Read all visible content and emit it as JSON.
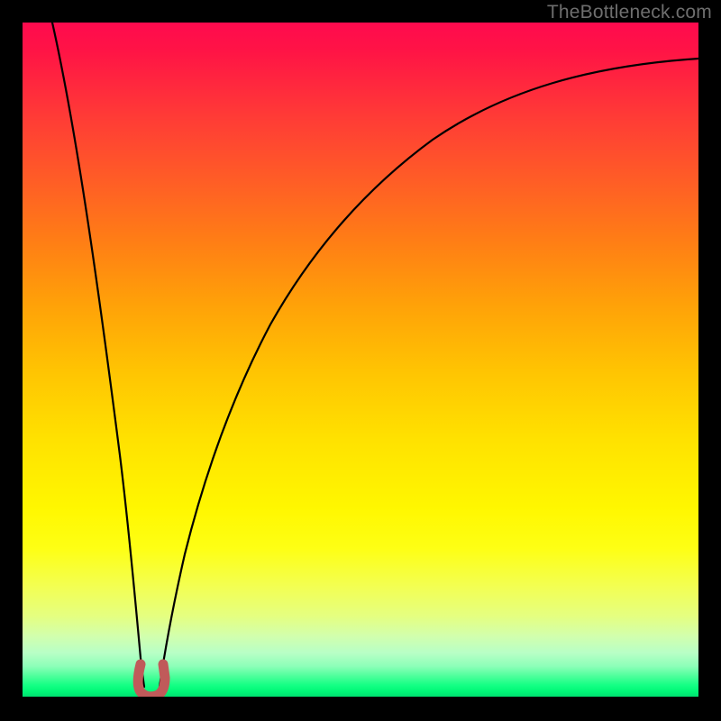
{
  "watermark": "TheBottleneck.com",
  "chart_data": {
    "type": "line",
    "title": "",
    "xlabel": "",
    "ylabel": "",
    "xlim": [
      0,
      100
    ],
    "ylim": [
      0,
      100
    ],
    "grid": false,
    "legend": false,
    "series": [
      {
        "name": "bottleneck-curve-left",
        "x": [
          0,
          2,
          4,
          6,
          8,
          10,
          12,
          14,
          15.5,
          16.5,
          17.3
        ],
        "values": [
          100,
          88,
          76,
          64,
          52,
          40,
          28,
          16,
          7,
          2,
          0.5
        ]
      },
      {
        "name": "bottleneck-curve-right",
        "x": [
          19.7,
          20.7,
          22,
          24,
          27,
          31,
          36,
          42,
          49,
          57,
          66,
          76,
          87,
          100
        ],
        "values": [
          0.5,
          2,
          6,
          13,
          23,
          34,
          45,
          55,
          64,
          72,
          79,
          85,
          90,
          94
        ]
      },
      {
        "name": "sweet-spot-marker",
        "x": [
          17.0,
          16.7,
          16.9,
          17.6,
          18.5,
          19.4,
          20.1,
          20.3,
          20.0
        ],
        "values": [
          4.0,
          2.3,
          0.9,
          0.2,
          0.1,
          0.2,
          0.9,
          2.3,
          4.0
        ]
      }
    ],
    "colors": {
      "curve": "#000000",
      "marker": "#c05a5a",
      "gradient_top": "#ff0a4e",
      "gradient_bottom": "#00e070"
    }
  }
}
